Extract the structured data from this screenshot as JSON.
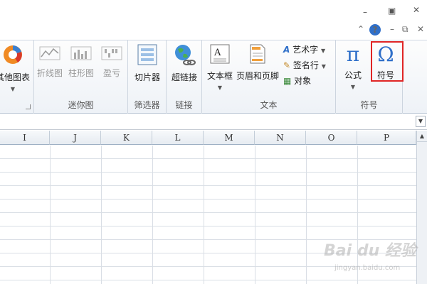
{
  "window": {
    "minimize": "–",
    "maximize": "▣",
    "close": "✕",
    "help": "?",
    "ribbon_collapse": "⌃",
    "doc_min": "–",
    "doc_restore": "⧉",
    "doc_close": "✕"
  },
  "ribbon": {
    "charts_group": {
      "other_charts": "其他图表"
    },
    "sparklines": {
      "line": "折线图",
      "column": "柱形图",
      "winloss": "盈亏",
      "label": "迷你图"
    },
    "filter": {
      "slicer": "切片器",
      "label": "筛选器"
    },
    "links": {
      "hyperlink": "超链接",
      "label": "链接"
    },
    "text": {
      "textbox": "文本框",
      "header_footer": "页眉和页脚",
      "wordart": "艺术字",
      "signature": "签名行",
      "object": "对象",
      "label": "文本"
    },
    "symbols": {
      "equation": "公式",
      "symbol": "符号",
      "label": "符号"
    }
  },
  "grid": {
    "columns": [
      "I",
      "J",
      "K",
      "L",
      "M",
      "N",
      "O",
      "P"
    ]
  },
  "watermark": {
    "main": "Bai du 经验",
    "sub": "jingyan.baidu.com"
  },
  "colors": {
    "highlight": "#e02525",
    "accent": "#2f6fc9"
  }
}
